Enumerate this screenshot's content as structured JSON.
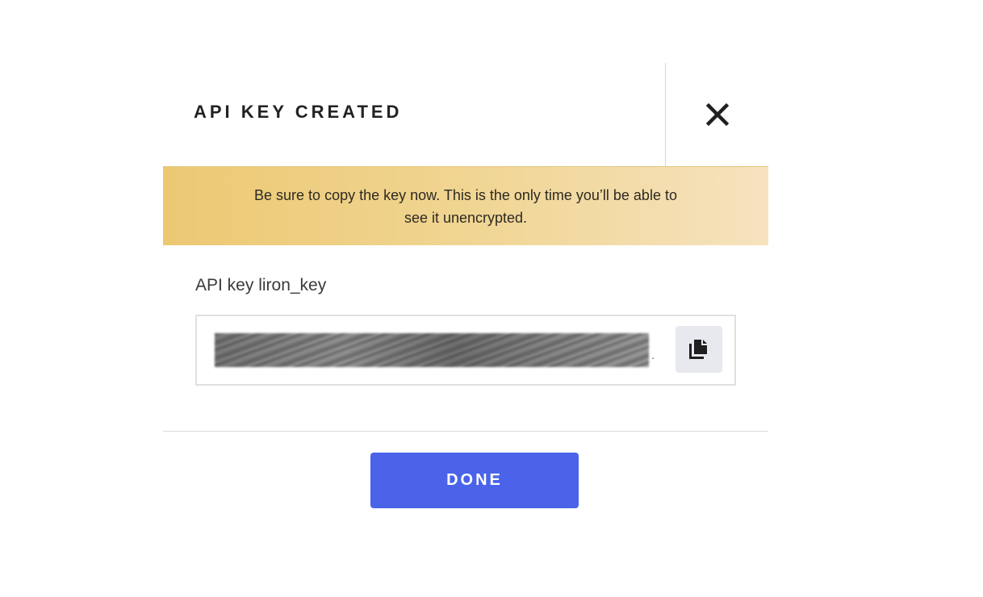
{
  "dialog": {
    "title": "API KEY CREATED",
    "close_icon": "close-icon"
  },
  "warning": {
    "message": "Be sure to copy the key now. This is the only time you’ll be able to see it unencrypted.",
    "background_from": "#ecc872",
    "background_to": "#f6e2be"
  },
  "api_key": {
    "label": "API key liron_key",
    "value_state": "redacted (blurred)",
    "trailing_text": ".",
    "copy_icon": "copy-icon"
  },
  "footer": {
    "done_label": "DONE",
    "done_color": "#4a63e9"
  }
}
